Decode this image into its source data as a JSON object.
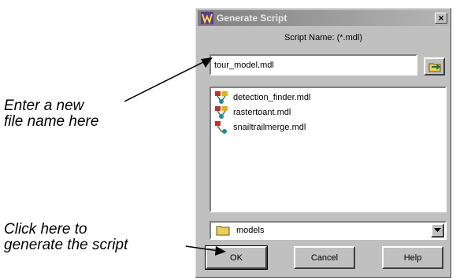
{
  "annotations": {
    "filename_line1": "Enter a new",
    "filename_line2": "file name here",
    "ok_line1": "Click here to",
    "ok_line2": "generate the script"
  },
  "dialog": {
    "title": "Generate Script",
    "close_glyph": "×",
    "script_name_label": "Script Name: (*.mdl)",
    "filename_value": "tour_model.mdl",
    "files": [
      {
        "name": "detection_finder.mdl",
        "icon": "model-file-icon"
      },
      {
        "name": "rastertoant.mdl",
        "icon": "model-file-icon"
      },
      {
        "name": "snailtrailmerge.mdl",
        "icon": "model-file-icon"
      }
    ],
    "directory": "models",
    "dropdown_glyph": "▼",
    "buttons": {
      "ok": "OK",
      "cancel": "Cancel",
      "help": "Help"
    }
  },
  "colors": {
    "dialog_bg": "#c0c0c0",
    "title_bar": "#808080",
    "title_text": "#e8e8e8"
  }
}
